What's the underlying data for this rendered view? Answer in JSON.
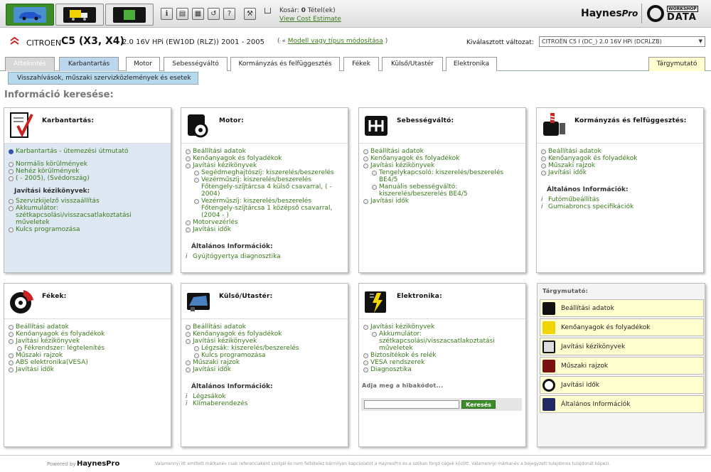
{
  "topbar": {
    "cart_label_prefix": "Kosár:",
    "cart_count": "0",
    "cart_label_suffix": "Tétel(ek)",
    "cart_link": "View Cost Estimate",
    "logo_haynes": "Haynes",
    "logo_pro": "Pro",
    "logo_workshop": "WORKSHOP",
    "logo_data": "DATA",
    "accent": "#3d8c2a"
  },
  "vehicle": {
    "make": "CITROEN",
    "model": "C5 (X3, X4)",
    "engine": "2.0 16V HPi (EW10D (RLZ)) 2001 - 2005",
    "modify_open": "( «",
    "modify_link": "Modell vagy típus módosítása",
    "modify_close": ")",
    "variant_label": "Kiválasztott változat:",
    "variant_value": "CITROËN  C5 I (DC_)  2.0 16V HPi (DCRLZB)"
  },
  "tabs": [
    {
      "label": "Áttekintés"
    },
    {
      "label": "Karbantartás"
    },
    {
      "label": "Motor"
    },
    {
      "label": "Sebességváltó"
    },
    {
      "label": "Kormányzás és felfüggesztés"
    },
    {
      "label": "Fékek"
    },
    {
      "label": "Külső/Utastér"
    },
    {
      "label": "Elektronika"
    },
    {
      "label": "Tárgymutató"
    }
  ],
  "subtab": "Visszahívások, műszaki szervizközlemények és esetek",
  "section_heading": "Információ keresése:",
  "panels": {
    "karbantartas": {
      "title": "Karbantartás:",
      "top_link": "Karbantartás - ütemezési útmutató",
      "items": [
        "Normális körülmények",
        "Nehéz körülmények",
        "( - 2005), (Svédország)"
      ],
      "sub_head": "Javítási kézikönyvek:",
      "items2": [
        "Szervizkijelző visszaállítás",
        "Akkumulátor: szétkapcsolási/visszacsatlakoztatási műveletek",
        "Kulcs programozása"
      ]
    },
    "motor": {
      "title": "Motor:",
      "items": [
        "Beállítási adatok",
        "Kenőanyagok és folyadékok",
        "Javítási kézikönyvek"
      ],
      "sub_items": [
        "Segédmeghajtószíj: kiszerelés/beszerelés",
        "Vezérműszíj: kiszerelés/beszerelés Főtengely-szíjtárcsa 4 külső csavarral, ( - 2004)",
        "Vezérműszíj: kiszerelés/beszerelés Főtengely-szíjtárcsa 1 középső csavarral, (2004 - )"
      ],
      "items2": [
        "Motorvezérlés",
        "Javítási idők"
      ],
      "sub_head": "Általános Információk:",
      "info": [
        "Gyújtógyertya diagnosztika"
      ]
    },
    "sebessegvalto": {
      "title": "Sebességváltó:",
      "items": [
        "Beállítási adatok",
        "Kenőanyagok és folyadékok",
        "Javítási kézikönyvek"
      ],
      "sub_items": [
        "Tengelykapcsoló: kiszerelés/beszerelés BE4/5",
        "Manuális sebességváltó: kiszerelés/beszerelés  BE4/5"
      ],
      "items2": [
        "Javítási idők"
      ]
    },
    "kormanyzas": {
      "title": "Kormányzás és felfüggesztés:",
      "items": [
        "Beállítási adatok",
        "Kenőanyagok és folyadékok",
        "Műszaki rajzok",
        "Javítási idők"
      ],
      "sub_head": "Általános Információk:",
      "info": [
        "Futóműbeállítás",
        "Gumiabroncs specifikációk"
      ]
    },
    "fekek": {
      "title": "Fékek:",
      "items": [
        "Beállítási adatok",
        "Kenőanyagok és folyadékok",
        "Javítási kézikönyvek"
      ],
      "sub_items": [
        "Fékrendszer: légtelenítés"
      ],
      "items2": [
        "Műszaki rajzok",
        "ABS elektronika(VESA)",
        "Javítási idők"
      ]
    },
    "kulso": {
      "title": "Külső/Utastér:",
      "items": [
        "Beállítási adatok",
        "Kenőanyagok és folyadékok",
        "Javítási kézikönyvek"
      ],
      "sub_items": [
        "Légzsák: kiszerelés/beszerelés",
        "Kulcs programozása"
      ],
      "items2": [
        "Műszaki rajzok",
        "Javítási idők"
      ],
      "sub_head": "Általános Információk:",
      "info": [
        "Légzsákok",
        "Klímaberendezés"
      ]
    },
    "elektronika": {
      "title": "Elektronika:",
      "items": [
        "Javítási kézikönyvek"
      ],
      "sub_items": [
        "Akkumulátor: szétkapcsolási/visszacsatlakoztatási műveletek"
      ],
      "items2": [
        "Biztosítékok és relék",
        "VESA rendszerek",
        "Diagnosztika"
      ],
      "hiba_label": "Adja meg a hibakódot...",
      "search_button": "Keresés"
    }
  },
  "index": {
    "title": "Tárgymutató:",
    "items": [
      "Beállítási adatok",
      "Kenőanyagok és folyadékok",
      "Javítási kézikönyvek",
      "Műszaki rajzok",
      "Javítási idők",
      "Általános Információk"
    ]
  },
  "footer": {
    "powered": "Powered by",
    "logo": "HaynesPro",
    "note": "Valamennyi itt említett márkanév csak referenciaként szolgál és nem feltételez bármilyen kapcsolatot a HaynesPro és a szóban forgó cégek között. Valamennyi márkanév a bejegyzett tulajdonos tulajdonát képezi."
  }
}
